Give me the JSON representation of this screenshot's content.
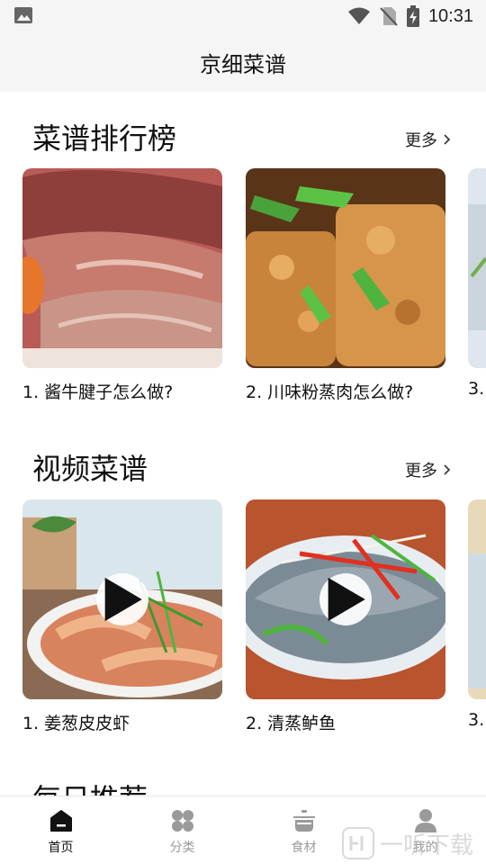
{
  "status_bar": {
    "time": "10:31"
  },
  "header": {
    "title": "京细菜谱"
  },
  "rankings": {
    "title": "菜谱排行榜",
    "more_label": "更多",
    "items": [
      {
        "caption": "1. 酱牛腱子怎么做?"
      },
      {
        "caption": "2. 川味粉蒸肉怎么做?"
      },
      {
        "caption": "3."
      }
    ]
  },
  "videos": {
    "title": "视频菜谱",
    "more_label": "更多",
    "items": [
      {
        "caption": "1. 姜葱皮皮虾"
      },
      {
        "caption": "2. 清蒸鲈鱼"
      },
      {
        "caption": "3."
      }
    ]
  },
  "daily": {
    "title": "每日推荐"
  },
  "tabbar": {
    "items": [
      {
        "label": "首页",
        "icon": "home-icon",
        "active": true
      },
      {
        "label": "分类",
        "icon": "category-icon",
        "active": false
      },
      {
        "label": "食材",
        "icon": "pot-icon",
        "active": false
      },
      {
        "label": "我的",
        "icon": "user-icon",
        "active": false
      }
    ]
  },
  "watermark": {
    "text": "一听下载"
  },
  "colors": {
    "active_tab": "#111111",
    "inactive_tab": "#9a9a9a",
    "header_bg": "#f5f5f5"
  }
}
